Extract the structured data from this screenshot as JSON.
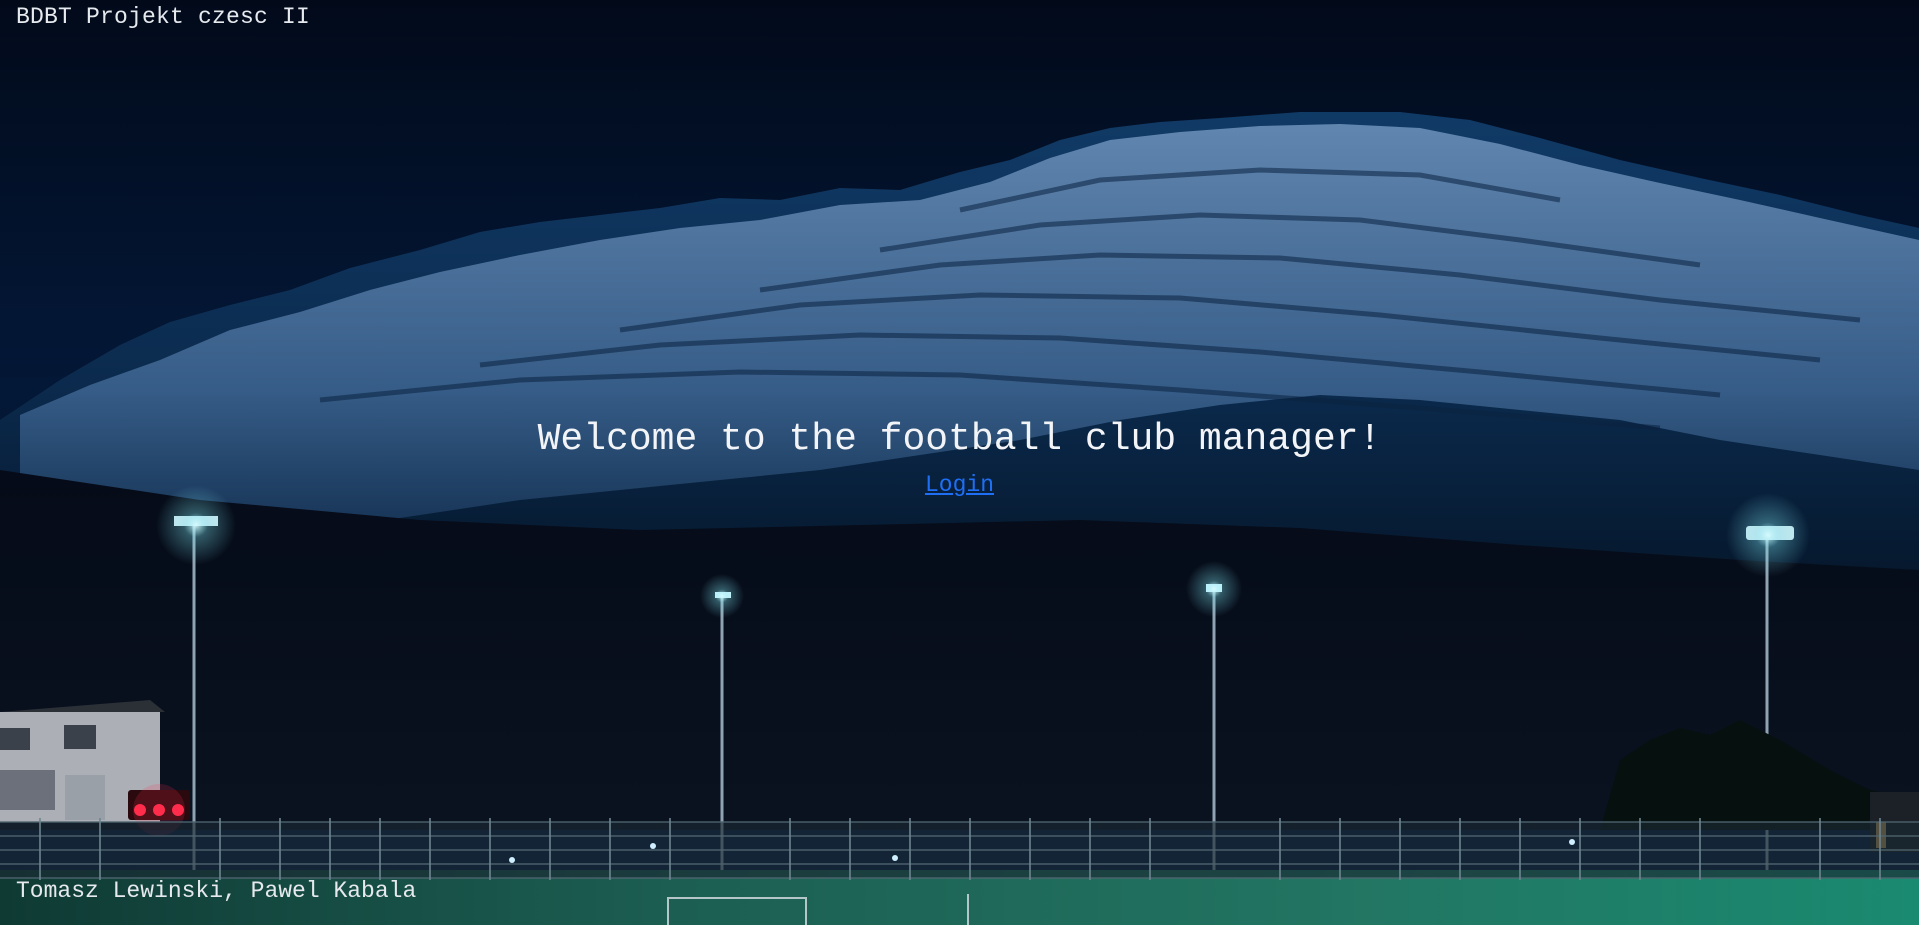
{
  "header": {
    "title": "BDBT Projekt czesc II"
  },
  "main": {
    "welcome_text": "Welcome to the football club manager!",
    "login_label": "Login"
  },
  "footer": {
    "authors": "Tomasz Lewinski, Pawel Kabala"
  },
  "background": {
    "scene": "night-mountain-football-field",
    "sky_color": "#031634",
    "snow_color": "#e8f2fb",
    "field_color": "#1e7a66",
    "light_color": "#bff7ff"
  }
}
